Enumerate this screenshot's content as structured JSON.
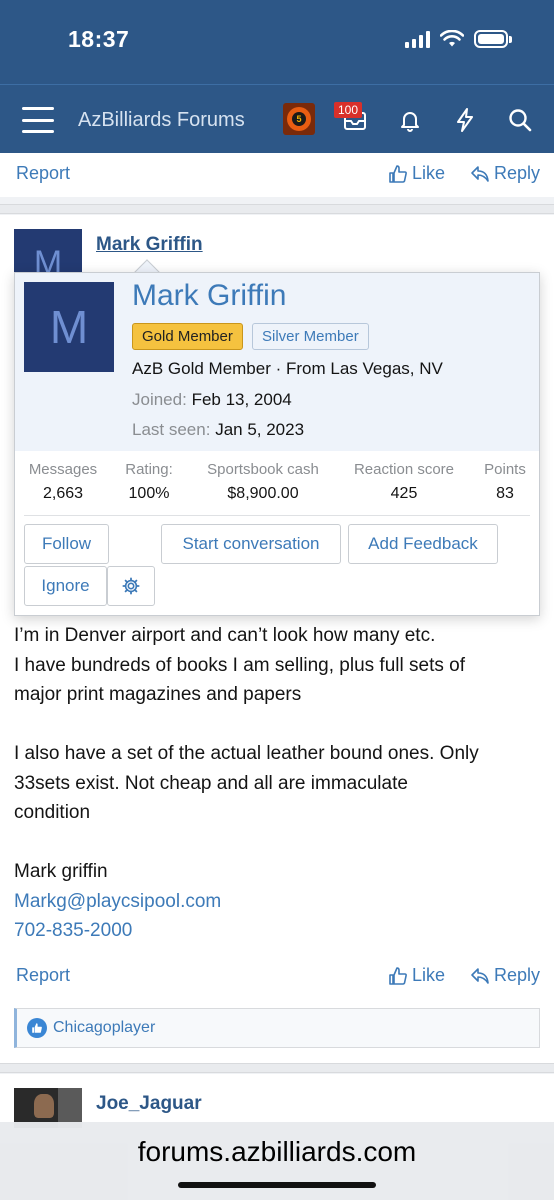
{
  "status_bar": {
    "time": "18:37"
  },
  "navbar": {
    "site_title": "AzBilliards Forums",
    "logo_number": "5",
    "notification_count": "100"
  },
  "previous_post_footer": {
    "report": "Report",
    "like": "Like",
    "reply": "Reply"
  },
  "post": {
    "author": "Mark Griffin",
    "avatar_letter": "M",
    "body_lines": [
      "I’m in Denver airport and can’t look how many etc.",
      "I have bundreds of books I am selling, plus full sets of",
      "major print magazines and papers",
      "",
      "I also have a set of the actual leather bound ones. Only",
      "33sets exist. Not cheap and all are immaculate",
      "condition",
      "",
      "Mark griffin"
    ],
    "email": "Markg@playcsipool.com",
    "phone": "702-835-2000",
    "footer": {
      "report": "Report",
      "like": "Like",
      "reply": "Reply"
    },
    "reaction_user": "Chicagoplayer"
  },
  "next_post": {
    "author": "Joe_Jaguar"
  },
  "popup": {
    "avatar_letter": "M",
    "name": "Mark Griffin",
    "badge_gold": "Gold Member",
    "badge_silver": "Silver Member",
    "user_title": "AzB Gold Member · From Las Vegas, NV",
    "joined_label": "Joined:",
    "joined_value": "Feb 13, 2004",
    "last_seen_label": "Last seen:",
    "last_seen_value": "Jan 5, 2023",
    "stats": [
      {
        "label": "Messages",
        "value": "2,663"
      },
      {
        "label": "Rating:",
        "value": "100%"
      },
      {
        "label": "Sportsbook cash",
        "value": "$8,900.00"
      },
      {
        "label": "Reaction score",
        "value": "425"
      },
      {
        "label": "Points",
        "value": "83"
      }
    ],
    "buttons": {
      "follow": "Follow",
      "start_conversation": "Start conversation",
      "add_feedback": "Add Feedback",
      "ignore": "Ignore"
    }
  },
  "url_bar": {
    "url": "forums.azbilliards.com"
  },
  "colors": {
    "header": "#2d5787",
    "link": "#3d7ab8",
    "gold_badge": "#f5c23f",
    "badge_red": "#d9302a"
  }
}
